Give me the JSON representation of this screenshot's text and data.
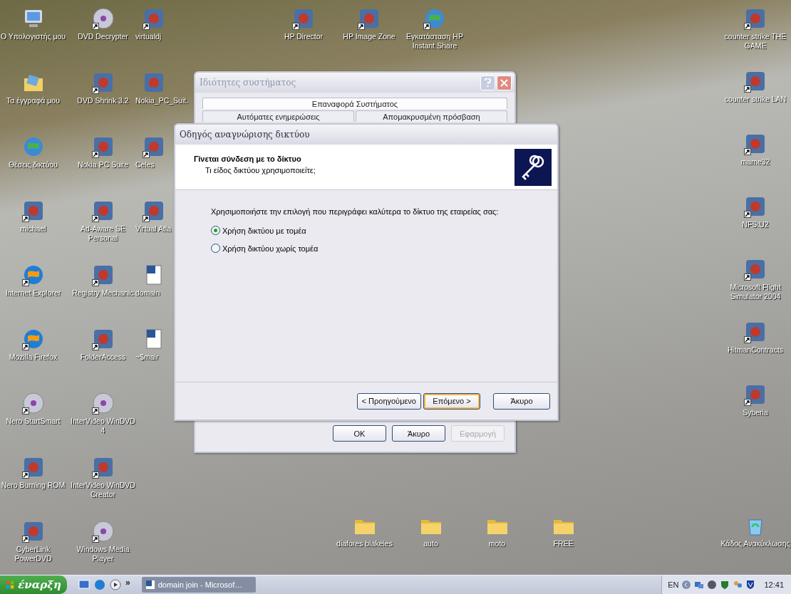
{
  "desktop": {
    "left_columns": [
      [
        {
          "label": "Ο Υπολογιστής μου",
          "kind": "computer",
          "shortcut": false
        },
        {
          "label": "Τα έγγραφά μου",
          "kind": "documents",
          "shortcut": false
        },
        {
          "label": "Θέσεις δικτύου",
          "kind": "network",
          "shortcut": false
        },
        {
          "label": "michael",
          "kind": "app",
          "shortcut": true
        },
        {
          "label": "Internet Explorer",
          "kind": "browser",
          "shortcut": true
        },
        {
          "label": "Mozilla Firefox",
          "kind": "browser",
          "shortcut": true
        },
        {
          "label": "Nero StartSmart",
          "kind": "disc",
          "shortcut": true
        },
        {
          "label": "Nero Burning ROM",
          "kind": "app",
          "shortcut": true
        },
        {
          "label": "CyberLink PowerDVD",
          "kind": "app",
          "shortcut": true
        }
      ],
      [
        {
          "label": "DVD Decrypter",
          "kind": "disc",
          "shortcut": true
        },
        {
          "label": "DVD Shrink 3.2",
          "kind": "app",
          "shortcut": true
        },
        {
          "label": "Nokia PC Suite",
          "kind": "app",
          "shortcut": true
        },
        {
          "label": "Ad-Aware SE Personal",
          "kind": "app",
          "shortcut": true
        },
        {
          "label": "Registry Mechanic",
          "kind": "app",
          "shortcut": true
        },
        {
          "label": "FolderAccess",
          "kind": "app",
          "shortcut": true
        },
        {
          "label": "InterVideo WinDVD 4",
          "kind": "disc",
          "shortcut": true
        },
        {
          "label": "InterVideo WinDVD Creator",
          "kind": "app",
          "shortcut": true
        },
        {
          "label": "Windows Media Player",
          "kind": "disc",
          "shortcut": true
        }
      ],
      [
        {
          "label": "virtualdj",
          "kind": "app",
          "shortcut": true
        },
        {
          "label": "Nokia_PC_Suit.",
          "kind": "app",
          "shortcut": false
        },
        {
          "label": "Celes",
          "kind": "app",
          "shortcut": true
        },
        {
          "label": "Virtual Atla",
          "kind": "app",
          "shortcut": true
        },
        {
          "label": "domain",
          "kind": "document",
          "shortcut": false
        },
        {
          "label": "~$mair",
          "kind": "document",
          "shortcut": false
        }
      ]
    ],
    "top_icons": [
      {
        "label": "HP Director",
        "kind": "app",
        "shortcut": true
      },
      {
        "label": "HP Image Zone",
        "kind": "app",
        "shortcut": true
      },
      {
        "label": "Εγκατάσταση HP Instant Share",
        "kind": "network",
        "shortcut": true
      }
    ],
    "right_column": [
      {
        "label": "counter strike THE GAME",
        "kind": "app",
        "shortcut": true
      },
      {
        "label": "counter strike LAN",
        "kind": "app",
        "shortcut": true
      },
      {
        "label": "mame32",
        "kind": "app",
        "shortcut": true
      },
      {
        "label": "NFS:U2",
        "kind": "app",
        "shortcut": true
      },
      {
        "label": "Microsoft Flight Simulator 2004",
        "kind": "app",
        "shortcut": true
      },
      {
        "label": "HitmanContracts",
        "kind": "app",
        "shortcut": true
      },
      {
        "label": "Syberia",
        "kind": "app",
        "shortcut": true
      }
    ],
    "bottom_folders": [
      {
        "label": "diafores blakeies",
        "kind": "folder",
        "shortcut": false
      },
      {
        "label": "auto",
        "kind": "folder",
        "shortcut": false
      },
      {
        "label": "moto",
        "kind": "folder",
        "shortcut": false
      },
      {
        "label": "FREE",
        "kind": "folder",
        "shortcut": false
      }
    ],
    "recycle_bin": {
      "label": "Κάδος Ανακύκλωσης",
      "kind": "recycle",
      "shortcut": false
    }
  },
  "system_properties": {
    "title": "Ιδιότητες συστήματος",
    "tabs": [
      {
        "label": "Επαναφορά Συστήματος",
        "selected": true
      },
      {
        "label": "Αυτόματες ενημερώσεις",
        "selected": false
      },
      {
        "label": "Απομακρυσμένη πρόσβαση",
        "selected": false
      }
    ],
    "buttons": [
      {
        "label": "OK",
        "disabled": false
      },
      {
        "label": "Άκυρο",
        "disabled": false
      },
      {
        "label": "Εφαρμογή",
        "disabled": true
      }
    ]
  },
  "wizard": {
    "title": "Οδηγός αναγνώρισης δικτύου",
    "heading": "Γίνεται σύνδεση με το δίκτυο",
    "subheading": "Τι είδος δικτύου χρησιμοποιείτε;",
    "prompt": "Χρησιμοποιήστε την επιλογή που περιγράφει καλύτερα το δίκτυο της εταιρείας σας:",
    "options": [
      {
        "label": "Χρήση δικτύου με τομέα",
        "selected": true
      },
      {
        "label": "Χρήση δικτύου χωρίς τομέα",
        "selected": false
      }
    ],
    "buttons": [
      {
        "label": "< Προηγούμενο",
        "default": false
      },
      {
        "label": "Επόμενο >",
        "default": true
      },
      {
        "label": "Άκυρο",
        "default": false
      }
    ]
  },
  "taskbar": {
    "start": "έναρξη",
    "chevron": "»",
    "tasks": [
      {
        "label": "domain join - Microsof…",
        "selected": false
      }
    ],
    "language": "EN",
    "clock": "12:41"
  }
}
